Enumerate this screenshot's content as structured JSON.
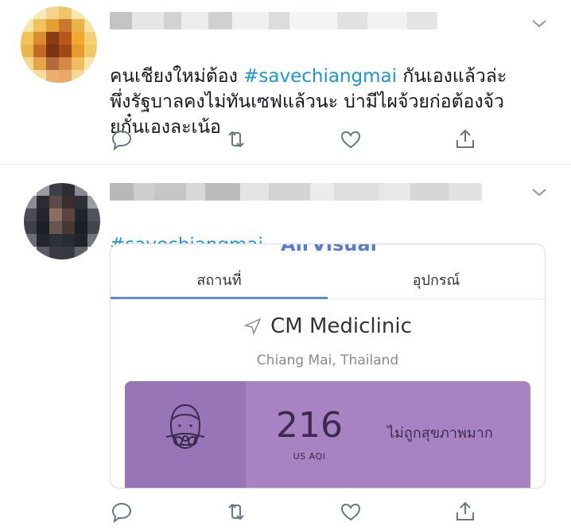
{
  "tweets": [
    {
      "text_line1_before": "คนเชียงใหม่ต้อง ",
      "hashtag": "#savechiangmai",
      "text_line1_after": " กันเองแล้วล่ะ",
      "text_rest": "พึ่งรัฐบาลคงไม่ทันเซฟแล้วนะ บ่ามีไผจ้วยก่อต้องจ้ว\nยกั๋นเองละเน้อ",
      "actions": [
        "reply-icon",
        "retweet-icon",
        "like-icon",
        "share-icon"
      ]
    },
    {
      "hashtag": "#savechiangmai",
      "card": {
        "brand": "AirVisual",
        "tabs": [
          "สถานที่",
          "อุปกรณ์"
        ],
        "location": "CM Mediclinic",
        "sublocation": "Chiang Mai, Thailand",
        "aqi_value": "216",
        "aqi_unit": "US AQI",
        "aqi_status": "ไม่ถูกสุขภาพมาก"
      },
      "actions": [
        "reply-icon",
        "retweet-icon",
        "like-icon",
        "share-icon"
      ]
    }
  ],
  "colors": {
    "hashtag": "#1b95e0",
    "aqi_panel": "#a783c4",
    "aqi_left": "#9775b7",
    "icon_gray": "#657786"
  }
}
